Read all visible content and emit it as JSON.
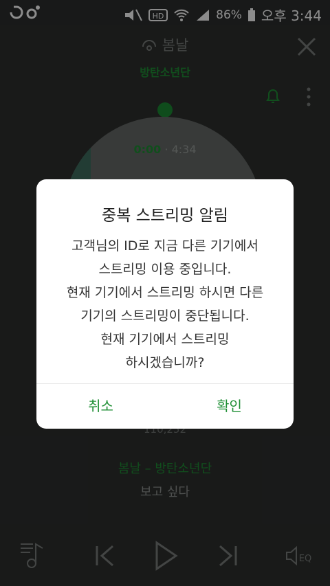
{
  "status_bar": {
    "battery": "86%",
    "time": "오후 3:44"
  },
  "player": {
    "song_title": "봄날",
    "artist": "방탄소년단",
    "elapsed": "0:00",
    "separator": "·",
    "duration": "4:34",
    "counter": "110,252",
    "now_playing": "봄날 – 방탄소년단",
    "lyric_line": "보고 싶다"
  },
  "dialog": {
    "title": "중복 스트리밍 알림",
    "lines": [
      "고객님의 ID로 지금 다른 기기에서",
      "스트리밍 이용 중입니다.",
      "현재 기기에서 스트리밍 하시면 다른",
      "기기의 스트리밍이 중단됩니다.",
      "현재 기기에서 스트리밍",
      "하시겠습니까?"
    ],
    "cancel_label": "취소",
    "confirm_label": "확인"
  },
  "colors": {
    "accent": "#1f8f35",
    "dialog_bg": "#ffffff",
    "overlay": "rgba(0,0,0,0.45)"
  }
}
